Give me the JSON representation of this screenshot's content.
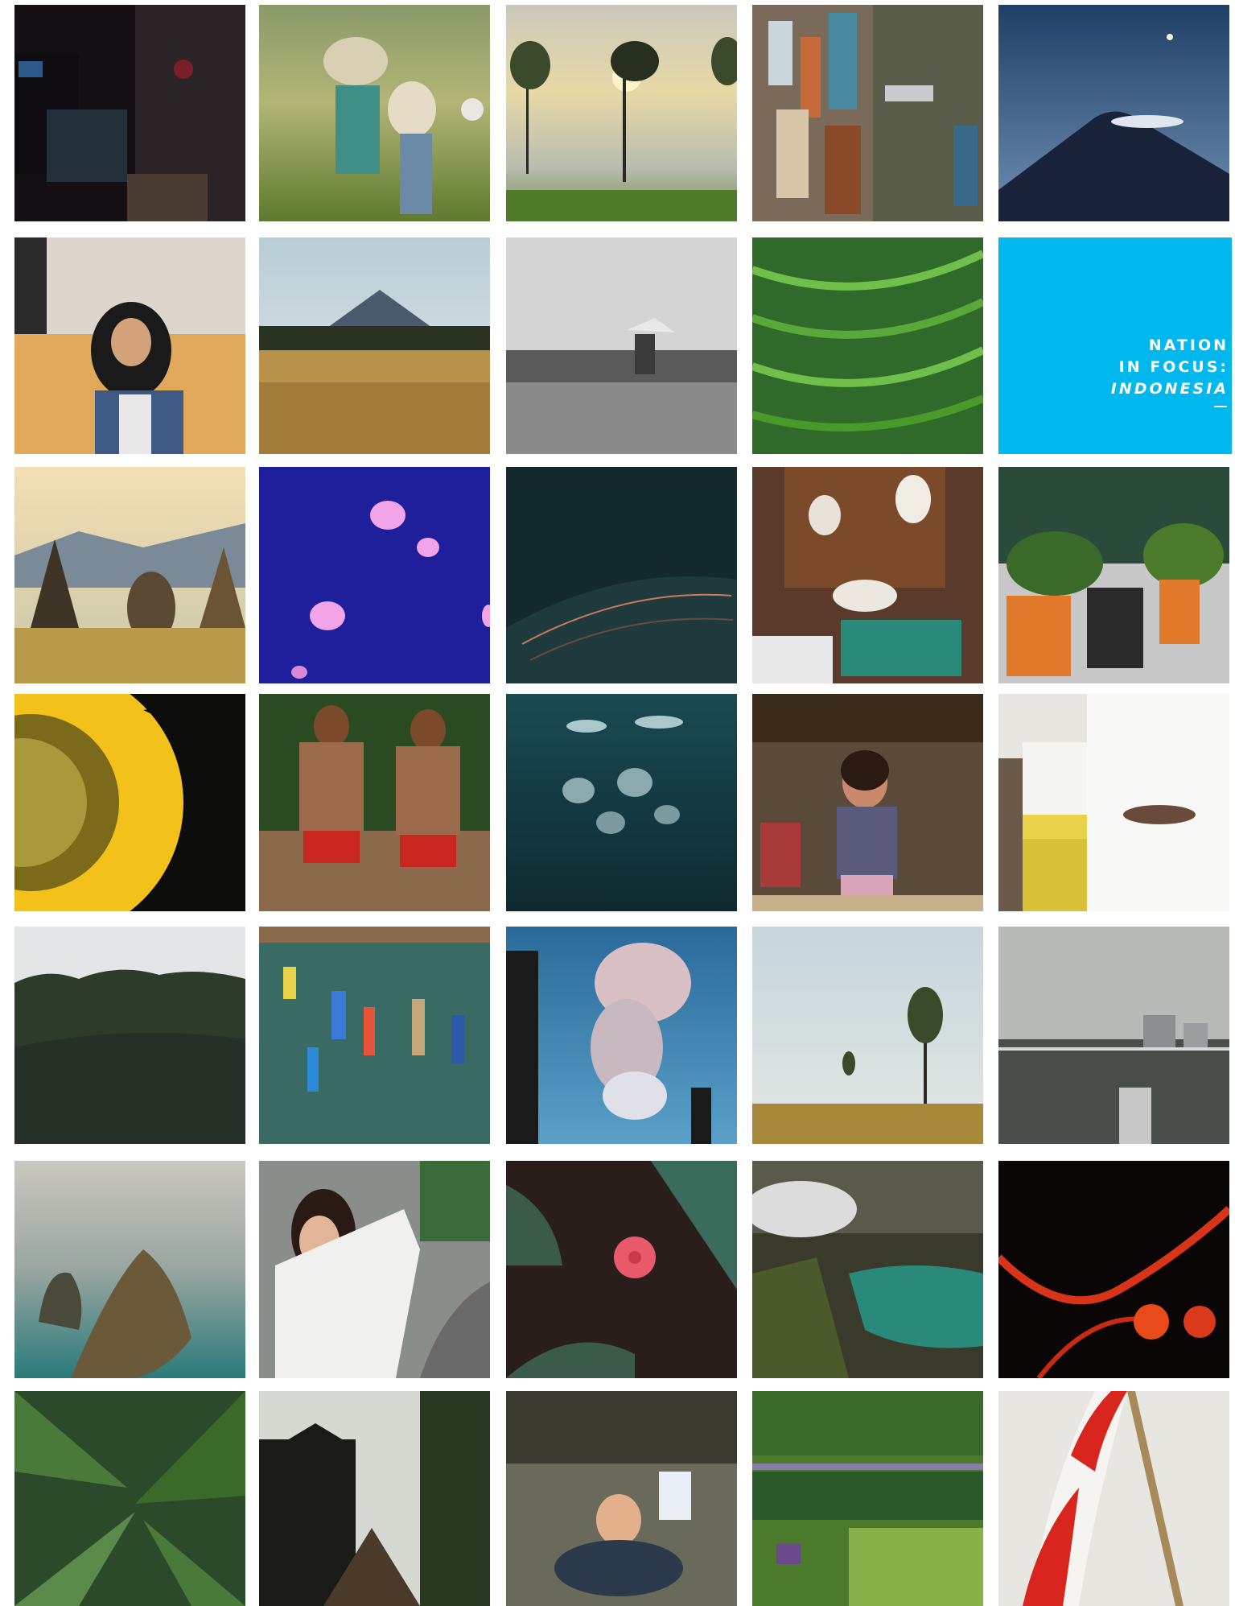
{
  "feature": {
    "line1": "NATION",
    "line2": "IN FOCUS:",
    "line3": "INDONESIA",
    "color": "#00b7ee"
  },
  "photos": [
    "dark-workshop",
    "rice-harvest-workers",
    "cyclists-at-sunrise",
    "aerial-harbor-boats",
    "volcano-at-night",
    "woman-in-hijab",
    "mountain-over-fields",
    "black-and-white-farmer",
    "aerial-rice-terraces",
    "borobudur-stupas",
    "pink-jellyfish",
    "dark-palm-leaf",
    "market-stall",
    "bird-cages-street",
    "sunflower",
    "tribal-men-portrait",
    "underwater-jellyfish",
    "smiling-girl",
    "traditional-dress-back",
    "palm-forest",
    "aerial-canoes",
    "volcano-eruption-smoke",
    "misty-field-trees",
    "railway-city-haze",
    "island-cliffs",
    "woman-white-sweater",
    "frangipani-flower",
    "crater-lake",
    "red-jellyfish",
    "palm-fronds",
    "jungle-path-temple",
    "child-in-bucket",
    "aerial-green-fields",
    "indonesian-flag"
  ]
}
